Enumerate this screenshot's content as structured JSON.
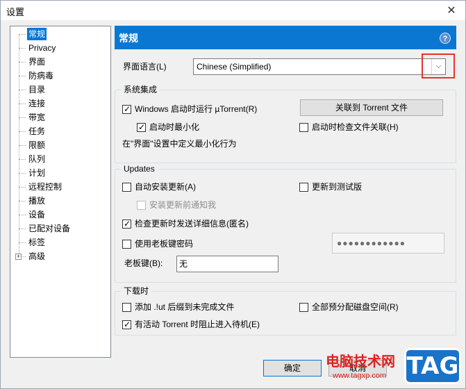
{
  "window": {
    "title": "设置",
    "close_label": "✕"
  },
  "tree": {
    "items": [
      {
        "label": "常规",
        "selected": true
      },
      {
        "label": "Privacy"
      },
      {
        "label": "界面"
      },
      {
        "label": "防病毒"
      },
      {
        "label": "目录"
      },
      {
        "label": "连接"
      },
      {
        "label": "带宽"
      },
      {
        "label": "任务"
      },
      {
        "label": "限额"
      },
      {
        "label": "队列"
      },
      {
        "label": "计划"
      },
      {
        "label": "远程控制"
      },
      {
        "label": "播放"
      },
      {
        "label": "设备"
      },
      {
        "label": "已配对设备"
      },
      {
        "label": "标签"
      },
      {
        "label": "高级",
        "expandable": true
      }
    ],
    "expander_label": "+"
  },
  "header": {
    "title": "常规",
    "help_label": "?"
  },
  "language": {
    "label": "界面语言(L)",
    "value": "Chinese (Simplified)",
    "arrow": "⌵"
  },
  "system": {
    "title": "系统集成",
    "run_on_startup": {
      "label": "Windows 启动时运行 µTorrent(R)",
      "checked": true
    },
    "start_minimized": {
      "label": "启动时最小化",
      "checked": true
    },
    "associate_button": "关联到 Torrent 文件",
    "check_assoc": {
      "label": "启动时检查文件关联(H)",
      "checked": false
    },
    "minimize_note": "在\"界面\"设置中定义最小化行为"
  },
  "updates": {
    "title": "Updates",
    "auto_install": {
      "label": "自动安装更新(A)",
      "checked": false
    },
    "beta": {
      "label": "更新到测试版",
      "checked": false
    },
    "notify_before": {
      "label": "安装更新前通知我",
      "checked": false
    },
    "send_info": {
      "label": "检查更新时发送详细信息(匿名)",
      "checked": true
    },
    "boss_key_pw": {
      "label": "使用老板键密码",
      "checked": false
    },
    "password_value": "●●●●●●●●●●●●",
    "boss_key_label": "老板键(B):",
    "boss_key_value": "无"
  },
  "download": {
    "title": "下载时",
    "append_ut": {
      "label": "添加 .!ut 后缀到未完成文件",
      "checked": false
    },
    "preallocate": {
      "label": "全部预分配磁盘空间(R)",
      "checked": false
    },
    "prevent_standby": {
      "label": "有活动 Torrent 时阻止进入待机(E)",
      "checked": true
    }
  },
  "footer": {
    "ok_label": "确定",
    "cancel_label": "取消"
  },
  "watermark": {
    "text": "电脑技术网",
    "url": "www.tagxp.com",
    "tag": "TAG"
  }
}
